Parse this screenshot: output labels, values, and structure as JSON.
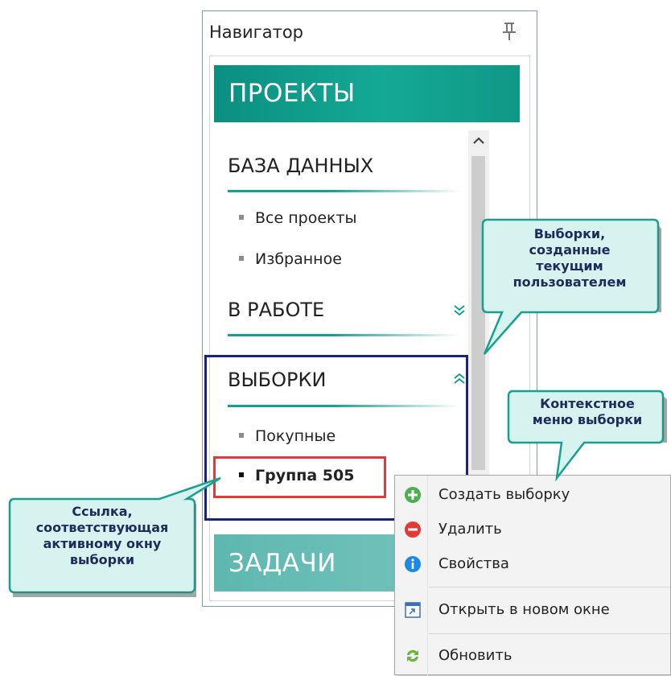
{
  "navigator": {
    "title": "Навигатор",
    "projects_header": "ПРОЕКТЫ",
    "tasks_header": "ЗАДАЧИ",
    "sections": {
      "database": {
        "title": "БАЗА ДАННЫХ",
        "items": [
          "Все проекты",
          "Избранное"
        ]
      },
      "in_work": {
        "title": "В РАБОТЕ"
      },
      "selections": {
        "title": "ВЫБОРКИ",
        "items": [
          "Покупные",
          "Группа 505"
        ]
      }
    }
  },
  "context_menu": {
    "items": [
      {
        "label": "Создать выборку",
        "icon": "plus-circle-icon"
      },
      {
        "label": "Удалить",
        "icon": "minus-circle-icon"
      },
      {
        "label": "Свойства",
        "icon": "info-icon"
      },
      {
        "label": "Открыть в новом окне",
        "icon": "window-icon"
      },
      {
        "label": "Обновить",
        "icon": "refresh-icon"
      }
    ]
  },
  "callouts": {
    "user_selections": [
      "Выборки,",
      "созданные",
      "текущим",
      "пользователем"
    ],
    "context_menu": [
      "Контекстное",
      "меню выборки"
    ],
    "active_link": [
      "Ссылка,",
      "соответствующая",
      "активному окну",
      "выборки"
    ]
  },
  "colors": {
    "teal_header": "#14a995",
    "teal_light": "#79c7bf",
    "selection_border": "#1a237e",
    "active_border": "#e53935",
    "callout_fill": "#d6f3ef",
    "callout_border": "#17a090"
  }
}
